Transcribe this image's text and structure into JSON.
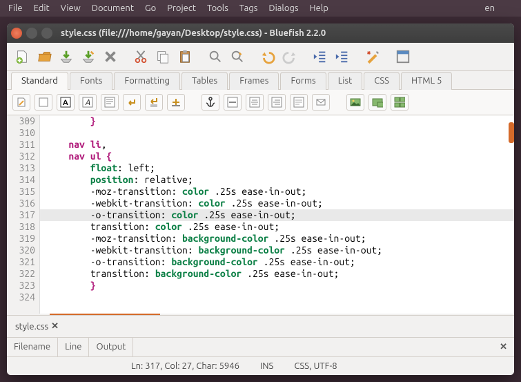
{
  "menubar": {
    "items": [
      "File",
      "Edit",
      "View",
      "Document",
      "Go",
      "Project",
      "Tools",
      "Tags",
      "Dialogs",
      "Help"
    ]
  },
  "system_tray": {
    "lang": "en"
  },
  "titlebar": {
    "text": "style.css (file:///home/gayan/Desktop/style.css) - Bluefish 2.2.0"
  },
  "tabs": [
    "Standard",
    "Fonts",
    "Formatting",
    "Tables",
    "Frames",
    "Forms",
    "List",
    "CSS",
    "HTML 5"
  ],
  "active_tab": 0,
  "code_lines": [
    {
      "n": 309,
      "html": "        <span class='sel'>}</span>"
    },
    {
      "n": 310,
      "html": ""
    },
    {
      "n": 311,
      "html": "    <span class='sel'>nav li</span>,"
    },
    {
      "n": 312,
      "html": "    <span class='sel'>nav ul {</span>"
    },
    {
      "n": 313,
      "html": "        <span class='prop'>float</span>: left;"
    },
    {
      "n": 314,
      "html": "        <span class='prop'>position</span>: relative;"
    },
    {
      "n": 315,
      "html": "        -moz-transition: <span class='prop2'>color</span> .25s ease-in-out;"
    },
    {
      "n": 316,
      "html": "        -webkit-transition: <span class='prop2'>color</span> .25s ease-in-out;"
    },
    {
      "n": 317,
      "html": "        -o-transition: <span class='prop2'>color</span> .25s ease-in-out;",
      "hl": true
    },
    {
      "n": 318,
      "html": "        transition: <span class='prop2'>color</span> .25s ease-in-out;"
    },
    {
      "n": 319,
      "html": "        -moz-transition: <span class='prop2'>background-color</span> .25s ease-in-out;"
    },
    {
      "n": 320,
      "html": "        -webkit-transition: <span class='prop2'>background-color</span> .25s ease-in-out;"
    },
    {
      "n": 321,
      "html": "        -o-transition: <span class='prop2'>background-color</span> .25s ease-in-out;"
    },
    {
      "n": 322,
      "html": "        transition: <span class='prop2'>background-color</span> .25s ease-in-out;"
    },
    {
      "n": 323,
      "html": "        <span class='sel'>}</span>"
    },
    {
      "n": 324,
      "html": ""
    }
  ],
  "filetab": {
    "name": "style.css"
  },
  "output": {
    "cols": [
      "Filename",
      "Line",
      "Output"
    ]
  },
  "statusbar": {
    "pos": "Ln: 317, Col: 27, Char: 5946",
    "ins": "INS",
    "mode": "CSS, UTF-8"
  }
}
